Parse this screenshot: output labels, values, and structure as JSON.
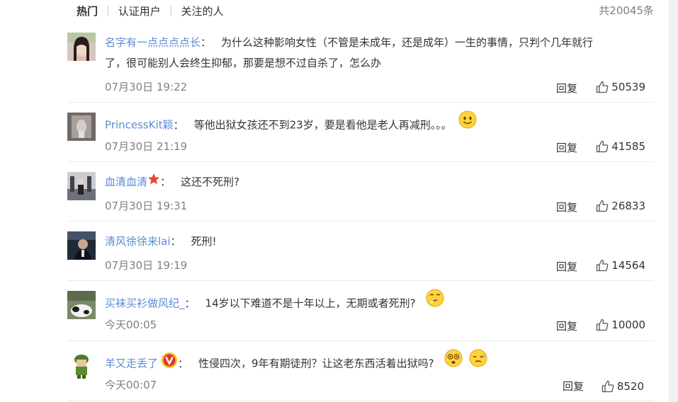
{
  "tabs": [
    "热门",
    "认证用户",
    "关注的人"
  ],
  "total": "共20045条",
  "comments": [
    {
      "user": "名字有一点点点点长",
      "text_line1": "为什么这种影响女性（不管是未成年，还是成年）一生的事情，只判个几年就行",
      "text_line2": "了，很可能别人会终生抑郁，那要是想不过自杀了，怎么办",
      "time": "07月30日 19:22",
      "reply": "回复",
      "likes": "50539"
    },
    {
      "user": "PrincessKit颖",
      "text": "等他出狱女孩还不到23岁，要是看他是老人再减刑。。。",
      "time": "07月30日 21:19",
      "reply": "回复",
      "likes": "41585"
    },
    {
      "user": "血清血清",
      "text": "这还不死刑?",
      "time": "07月30日 19:31",
      "reply": "回复",
      "likes": "26833"
    },
    {
      "user": "清风徐徐来lai",
      "text": "死刑!",
      "time": "07月30日 19:19",
      "reply": "回复",
      "likes": "14564"
    },
    {
      "user": "买袜买衫做风纪_",
      "text": "14岁以下难道不是十年以上，无期或者死刑?",
      "time": "今天00:05",
      "reply": "回复",
      "likes": "10000"
    },
    {
      "user": "羊又走丢了",
      "text": "性侵四次，9年有期徒刑？让这老东西活着出狱吗?",
      "time": "今天00:07",
      "reply": "回复",
      "likes": "8520"
    }
  ],
  "colors": {
    "username": "#5a8bd5",
    "meta": "#808080",
    "divider": "#eaeaea"
  },
  "icons": [
    "thumb-up-icon",
    "smile-emoji",
    "star-badge-icon",
    "vip-v-badge-icon",
    "dizzy-emoji",
    "sweat-emoji",
    "thinking-emoji"
  ]
}
